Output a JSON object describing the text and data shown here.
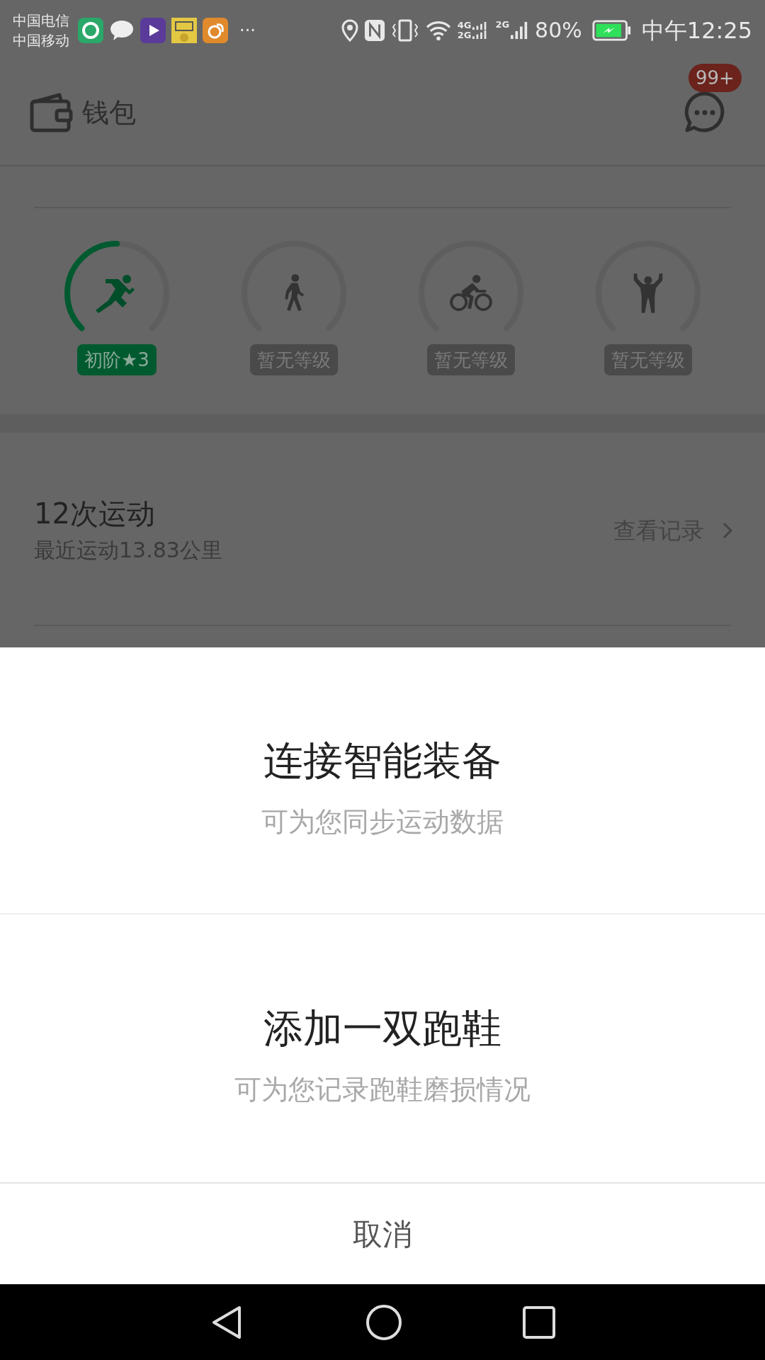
{
  "status_bar": {
    "carriers": [
      "中国电信",
      "中国移动"
    ],
    "overflow": "···",
    "network_top": "4G",
    "network_bottom": "2G",
    "network_single": "2G",
    "battery": "80%",
    "time": "中午12:25"
  },
  "header": {
    "title": "钱包",
    "message_badge": "99+"
  },
  "activities": [
    {
      "kind": "run",
      "achieved": true,
      "badge": "初阶★3"
    },
    {
      "kind": "walk",
      "achieved": false,
      "badge": "暂无等级"
    },
    {
      "kind": "cycle",
      "achieved": false,
      "badge": "暂无等级"
    },
    {
      "kind": "strength",
      "achieved": false,
      "badge": "暂无等级"
    }
  ],
  "summary": {
    "title": "12次运动",
    "subtitle": "最近运动13.83公里",
    "link": "查看记录"
  },
  "sheet": {
    "options": [
      {
        "title": "连接智能装备",
        "subtitle": "可为您同步运动数据"
      },
      {
        "title": "添加一双跑鞋",
        "subtitle": "可为您记录跑鞋磨损情况"
      }
    ],
    "cancel": "取消"
  }
}
